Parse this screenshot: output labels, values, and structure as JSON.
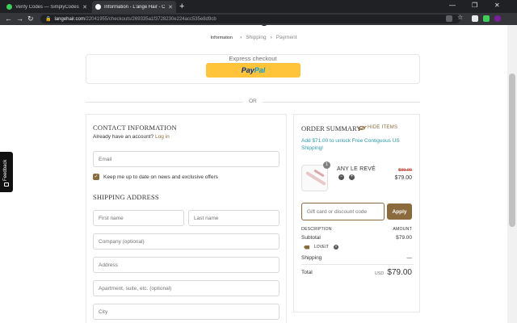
{
  "browser": {
    "tabs": [
      {
        "title": "Verify Codes — SimplyCodes",
        "favicon_color": "#3ecf5a",
        "active": false
      },
      {
        "title": "Information - L'ange Hair - Chec",
        "favicon_color": "#ffffff",
        "active": true
      }
    ],
    "new_tab_label": "+",
    "window_controls": [
      "—",
      "❐",
      "✕"
    ],
    "nav": {
      "back": "←",
      "forward": "→",
      "reload": "↻"
    },
    "url_host": "langehair.com",
    "url_path": "/22041955/checkouts/269335a1f3728230e224acc535e8d9cb"
  },
  "breadcrumb": {
    "items": [
      "Information",
      "Shipping",
      "Payment"
    ],
    "separator": "›"
  },
  "express": {
    "title": "Express checkout",
    "paypal_pay": "Pay",
    "paypal_pal": "Pal"
  },
  "or_label": "OR",
  "contact": {
    "title": "CONTACT INFORMATION",
    "have_account": "Already have an account?",
    "login_link": "Log in",
    "email_placeholder": "Email",
    "newsletter_label": "Keep me up to date on news and exclusive offers",
    "newsletter_checked": true
  },
  "shipping": {
    "title": "SHIPPING ADDRESS",
    "first_name": "First name",
    "last_name": "Last name",
    "company": "Company (optional)",
    "address": "Address",
    "apartment": "Apartment, suite, etc. (optional)",
    "city": "City"
  },
  "summary": {
    "title": "ORDER SUMMARY",
    "hide_items": "HIDE ITEMS",
    "promo": "Add $71.00 to unlock Free Contiguous US Shipping!",
    "product": {
      "name": "ANY LE REVÉ",
      "qty": "1",
      "price_original": "$99.00",
      "price": "$79.00",
      "minus": "−",
      "plus": "+"
    },
    "gift_placeholder": "Gift card or discount code",
    "apply_label": "Apply",
    "col_description": "DESCRIPTION",
    "col_amount": "AMOUNT",
    "subtotal_label": "Subtotal",
    "subtotal_value": "$79.00",
    "discount_code": "LOVEIT",
    "discount_remove": "×",
    "shipping_label": "Shipping",
    "shipping_value": "—",
    "total_label": "Total",
    "total_currency": "USD",
    "total_value": "$79.00"
  },
  "feedback_label": "Feedback",
  "colors": {
    "accent": "#8b6a3e",
    "promo": "#2b9aa8",
    "paypal": "#ffc439"
  }
}
